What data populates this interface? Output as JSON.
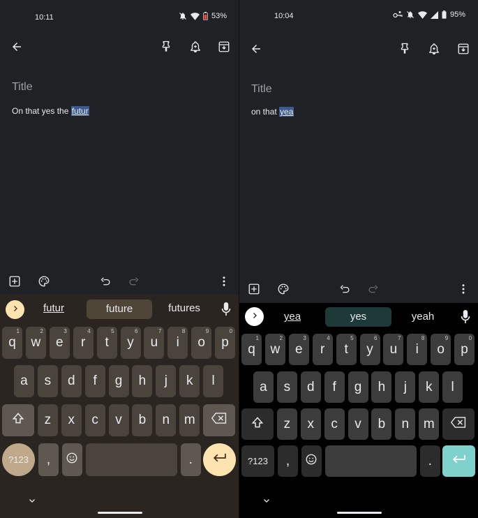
{
  "left": {
    "status": {
      "time": "10:11",
      "battery": "53%"
    },
    "note": {
      "title_placeholder": "Title",
      "text_before": "On that yes the ",
      "text_selected": "futur"
    },
    "suggestions": [
      "futur",
      "future",
      "futures"
    ],
    "keys": {
      "row1": [
        [
          "q",
          "1"
        ],
        [
          "w",
          "2"
        ],
        [
          "e",
          "3"
        ],
        [
          "r",
          "4"
        ],
        [
          "t",
          "5"
        ],
        [
          "y",
          "6"
        ],
        [
          "u",
          "7"
        ],
        [
          "i",
          "8"
        ],
        [
          "o",
          "9"
        ],
        [
          "p",
          "0"
        ]
      ],
      "row2": [
        "a",
        "s",
        "d",
        "f",
        "g",
        "h",
        "j",
        "k",
        "l"
      ],
      "row3": [
        "z",
        "x",
        "c",
        "v",
        "b",
        "n",
        "m"
      ],
      "symbols": "?123",
      "comma": ",",
      "period": "."
    },
    "colors": {
      "key": "#4a443d",
      "special_key": "#5e5850",
      "accent": "#fde3b0",
      "suggest_highlight": "#4f4638"
    }
  },
  "right": {
    "status": {
      "time": "10:04",
      "battery": "95%"
    },
    "note": {
      "title_placeholder": "Title",
      "text_before": "on that ",
      "text_selected": "yea"
    },
    "suggestions": [
      "yea",
      "yes",
      "yeah"
    ],
    "keys": {
      "row1": [
        [
          "q",
          "1"
        ],
        [
          "w",
          "2"
        ],
        [
          "e",
          "3"
        ],
        [
          "r",
          "4"
        ],
        [
          "t",
          "5"
        ],
        [
          "y",
          "6"
        ],
        [
          "u",
          "7"
        ],
        [
          "i",
          "8"
        ],
        [
          "o",
          "9"
        ],
        [
          "p",
          "0"
        ]
      ],
      "row2": [
        "a",
        "s",
        "d",
        "f",
        "g",
        "h",
        "j",
        "k",
        "l"
      ],
      "row3": [
        "z",
        "x",
        "c",
        "v",
        "b",
        "n",
        "m"
      ],
      "symbols": "?123",
      "comma": ",",
      "period": "."
    },
    "colors": {
      "key": "#3c3c3c",
      "special_key": "#2c2c2c",
      "accent": "#7fd1cc",
      "suggest_highlight": "#1e3a38"
    }
  }
}
